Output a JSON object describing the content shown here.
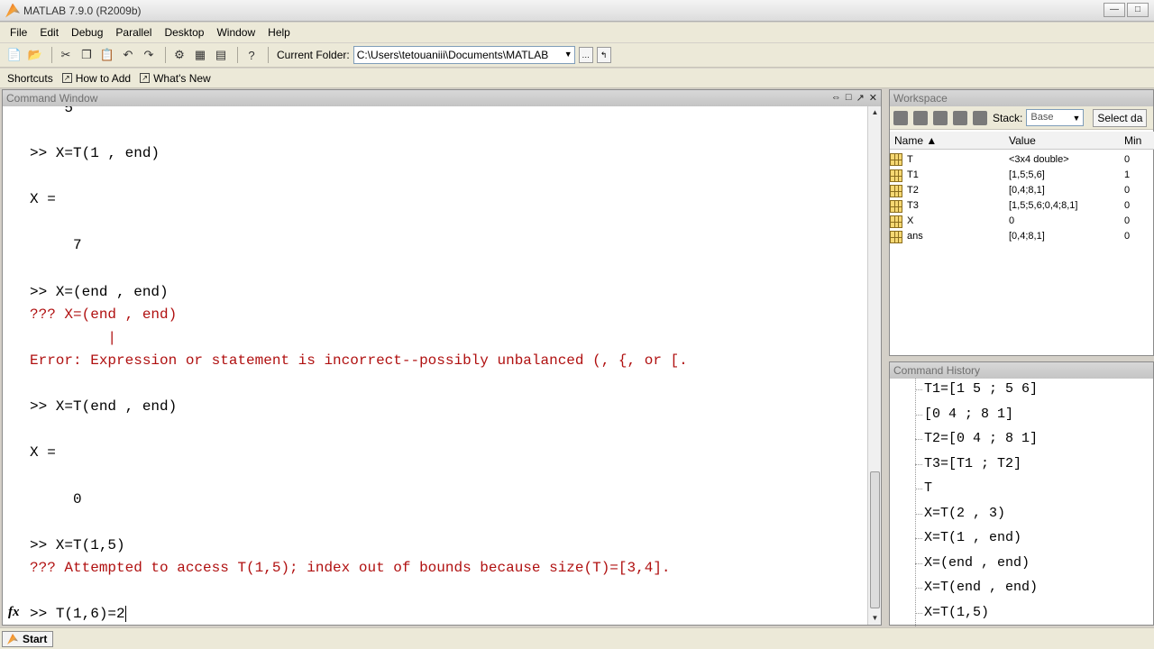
{
  "window": {
    "title": "MATLAB 7.9.0 (R2009b)"
  },
  "menu": [
    "File",
    "Edit",
    "Debug",
    "Parallel",
    "Desktop",
    "Window",
    "Help"
  ],
  "toolbar": {
    "current_folder_label": "Current Folder:",
    "current_folder_value": "C:\\Users\\tetouaniii\\Documents\\MATLAB"
  },
  "shortcuts": {
    "label": "Shortcuts",
    "how_to_add": "How to Add",
    "whats_new": "What's New"
  },
  "command_window": {
    "title": "Command Window",
    "prompt": ">> ",
    "current_input": "T(1,6)=2",
    "lines": [
      {
        "text": "    5",
        "type": "out"
      },
      {
        "text": ">> X=T(1 , end)",
        "type": "cmd"
      },
      {
        "text": "X =",
        "type": "out"
      },
      {
        "text": "     7",
        "type": "out"
      },
      {
        "text": ">> X=(end , end)",
        "type": "cmd"
      },
      {
        "text": "??? X=(end , end)",
        "type": "err"
      },
      {
        "text": "         |",
        "type": "err"
      },
      {
        "text": "Error: Expression or statement is incorrect--possibly unbalanced (, {, or [.",
        "type": "err"
      },
      {
        "text": ">> X=T(end , end)",
        "type": "cmd"
      },
      {
        "text": "X =",
        "type": "out"
      },
      {
        "text": "     0",
        "type": "out"
      },
      {
        "text": ">> X=T(1,5)",
        "type": "cmd"
      },
      {
        "text": "??? Attempted to access T(1,5); index out of bounds because size(T)=[3,4].",
        "type": "err"
      }
    ]
  },
  "workspace": {
    "title": "Workspace",
    "stack_label": "Stack:",
    "stack_value": "Base",
    "select_data_label": "Select da",
    "columns": [
      "Name ▲",
      "Value",
      "Min"
    ],
    "variables": [
      {
        "name": "T",
        "value": "<3x4 double>",
        "min": "0"
      },
      {
        "name": "T1",
        "value": "[1,5;5,6]",
        "min": "1"
      },
      {
        "name": "T2",
        "value": "[0,4;8,1]",
        "min": "0"
      },
      {
        "name": "T3",
        "value": "[1,5;5,6;0,4;8,1]",
        "min": "0"
      },
      {
        "name": "X",
        "value": "0",
        "min": "0"
      },
      {
        "name": "ans",
        "value": "[0,4;8,1]",
        "min": "0"
      }
    ]
  },
  "command_history": {
    "title": "Command History",
    "entries": [
      "T1=[1 5 ; 5 6]",
      "[0 4 ; 8 1]",
      "T2=[0 4 ; 8 1]",
      "T3=[T1 ; T2]",
      "T",
      "X=T(2 , 3)",
      "X=T(1 , end)",
      "X=(end , end)",
      "X=T(end , end)",
      "X=T(1,5)"
    ]
  },
  "status": {
    "start_label": "Start"
  }
}
